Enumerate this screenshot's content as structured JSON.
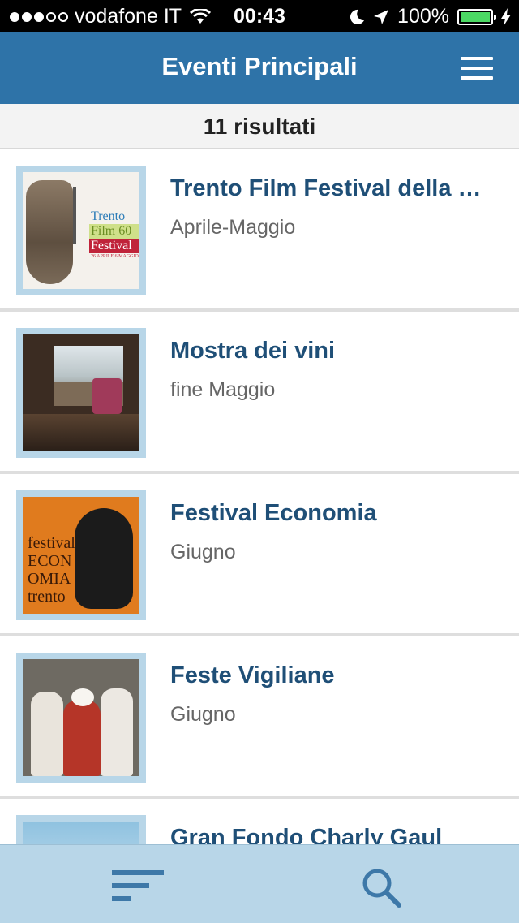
{
  "status_bar": {
    "carrier": "vodafone IT",
    "time": "00:43",
    "battery": "100%",
    "signal_bars_filled": 3,
    "signal_bars_total": 5,
    "icons": [
      "wifi-icon",
      "moon-icon",
      "location-arrow-icon",
      "battery-icon",
      "charging-bolt-icon"
    ]
  },
  "header": {
    "title": "Eventi Principali",
    "menu_icon": "hamburger-menu-icon"
  },
  "results": {
    "label": "11 risultati"
  },
  "events": [
    {
      "name": "Trento Film Festival della Montagna",
      "date": "Aprile-Maggio",
      "thumbnail_text": [
        "Trento",
        "Film 60",
        "Festival",
        "26 APRILE 6 MAGGIO"
      ]
    },
    {
      "name": "Mostra dei vini",
      "date": "fine Maggio"
    },
    {
      "name": "Festival Economia",
      "date": "Giugno",
      "thumbnail_text": [
        "festival",
        "ECON",
        "OMIA",
        "trento"
      ]
    },
    {
      "name": "Feste Vigiliane",
      "date": "Giugno"
    },
    {
      "name": "Gran Fondo Charly Gaul",
      "date": ""
    }
  ],
  "tab_bar": {
    "filter_icon": "filter-sort-icon",
    "search_icon": "search-icon"
  },
  "colors": {
    "nav_bar": "#2e73a8",
    "title_text": "#1f4f77",
    "thumb_frame": "#b8d6e8",
    "tab_bar": "#b8d6e8",
    "tab_icon": "#3d78a8"
  }
}
